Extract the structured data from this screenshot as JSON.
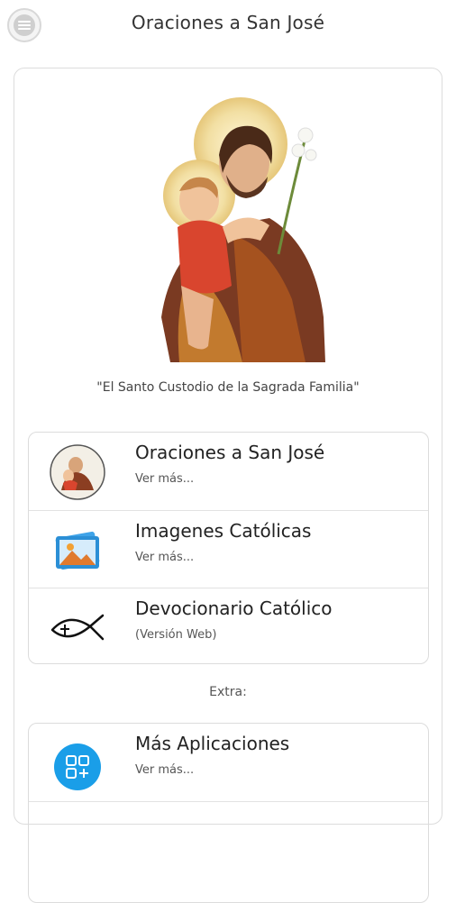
{
  "header": {
    "title": "Oraciones a San José",
    "menu_icon": "hamburger-menu-icon"
  },
  "hero": {
    "image": "saint-joseph-with-child-jesus-image",
    "caption": "\"El Santo Custodio de la Sagrada Familia\""
  },
  "main_links": [
    {
      "label": "Oraciones a San José",
      "sub": "Ver más...",
      "icon": "saint-joseph-medallion-icon"
    },
    {
      "label": "Imagenes Católicas",
      "sub": "Ver más...",
      "icon": "image-gallery-icon"
    },
    {
      "label": "Devocionario Católico",
      "sub": "(Versión Web)",
      "icon": "ichthys-fish-icon"
    }
  ],
  "extra_label": "Extra:",
  "extra_links": [
    {
      "label": "Más Aplicaciones",
      "sub": "Ver más...",
      "icon": "apps-grid-icon",
      "color": "#1a9ee8"
    }
  ],
  "colors": {
    "accent_blue": "#1a9ee8",
    "border": "#dcdcdc"
  }
}
